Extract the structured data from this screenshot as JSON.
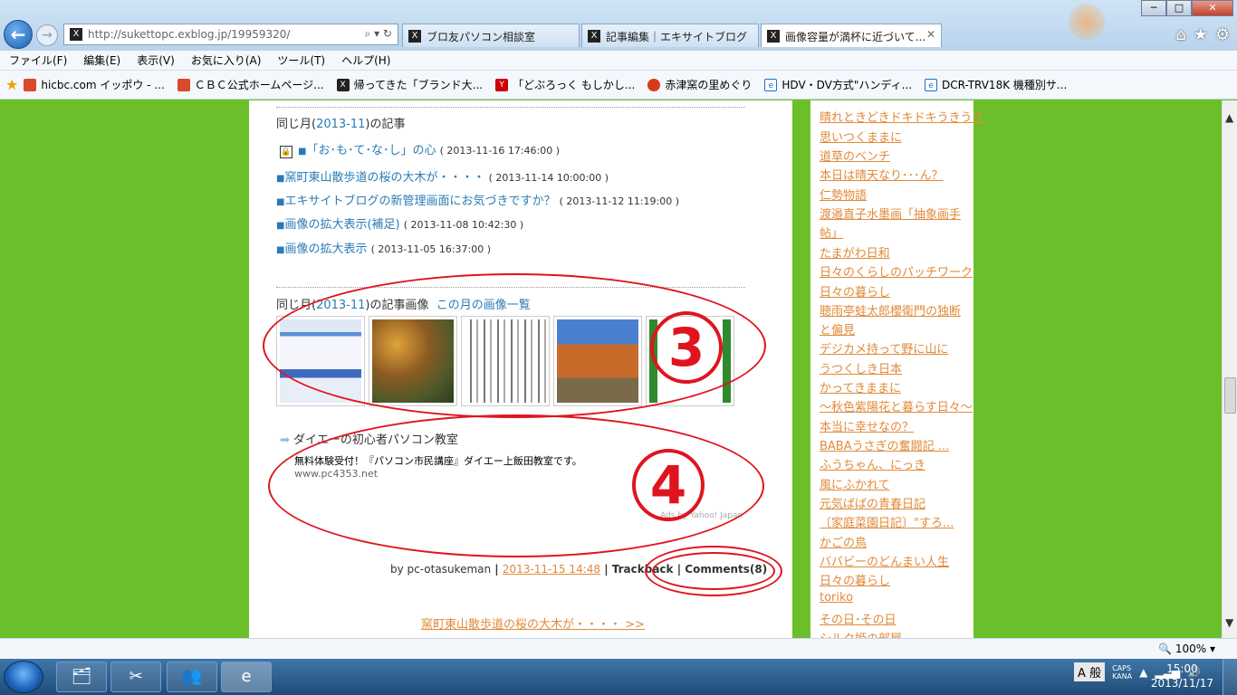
{
  "browser": {
    "address_url": "http://sukettopc.exblog.jp/19959320/",
    "tabs": [
      {
        "label": "ブロ友パソコン相談室"
      },
      {
        "label": "記事編集｜エキサイトブログ"
      },
      {
        "label": "画像容量が満杯に近づいて..."
      }
    ],
    "window_controls": {
      "minimize": "─",
      "maximize": "□",
      "close": "✕"
    },
    "tool_icons": {
      "home": "⌂",
      "favorites": "★",
      "tools": "⚙"
    }
  },
  "menu": [
    "ファイル(F)",
    "編集(E)",
    "表示(V)",
    "お気に入り(A)",
    "ツール(T)",
    "ヘルプ(H)"
  ],
  "favorites": [
    {
      "label": "hicbc.com  イッポウ - ...",
      "color": "#d84a2a"
    },
    {
      "label": "ＣＢＣ公式ホームページ...",
      "color": "#d84a2a"
    },
    {
      "label": "帰ってきた「ブランド大...",
      "color": "#222222"
    },
    {
      "label": "「どぶろっく もしかし...",
      "color": "#cc0000"
    },
    {
      "label": "赤津窯の里めぐり",
      "color": "#d83a1a"
    },
    {
      "label": "HDV・DV方式\"ハンディ...",
      "color": "#1a6fd8"
    },
    {
      "label": "DCR-TRV18K  機種別サ...",
      "color": "#1a6fd8"
    }
  ],
  "article": {
    "same_month_prefix": "同じ月(",
    "same_month_link": "2013-11",
    "same_month_suffix": ")の記事",
    "posts": [
      {
        "title": "「お･も･て･な･し」の心",
        "date": "( 2013-11-16 17:46:00 )",
        "locked": true
      },
      {
        "title": "窯町東山散歩道の桜の大木が・・・・",
        "date": "( 2013-11-14 10:00:00 )",
        "locked": false
      },
      {
        "title": "エキサイトブログの新管理画面にお気づきですか？",
        "date": "( 2013-11-12 11:19:00 )",
        "locked": false
      },
      {
        "title": "画像の拡大表示(補足)",
        "date": "( 2013-11-08 10:42:30 )",
        "locked": false
      },
      {
        "title": "画像の拡大表示",
        "date": "( 2013-11-05 16:37:00 )",
        "locked": false
      }
    ],
    "images_prefix": "同じ月(",
    "images_link": "2013-11",
    "images_suffix": ")の記事画像",
    "images_list_link": "この月の画像一覧",
    "ad": {
      "title": "ダイエーの初心者パソコン教室",
      "text": "無料体験受付！『パソコン市民講座』ダイエー上飯田教室です。",
      "url": "www.pc4353.net",
      "by": "Ads by Yahoo! Japan"
    },
    "byline_by": "by pc-otasukeman",
    "byline_sep": " | ",
    "byline_date": "2013-11-15 14:48",
    "byline_trackback": "Trackback",
    "byline_comments": "Comments(8)",
    "next_link": "窯町東山散歩道の桜の大木が・・・・ >>"
  },
  "sidebar": [
    "晴れときどきドキドキうきうき",
    "思いつくままに",
    "道草のベンチ",
    "本日は晴天なり･･･ん？",
    "仁勢物語",
    "渡邉直子水墨画「抽象画手",
    "帖」",
    "たまがわ日和",
    "日々のくらしのパッチワーク",
    "日々の暮らし",
    "聴雨亭蛙太郎櫻衛門の独断",
    "と偏見",
    "デジカメ持って野に山に",
    "うつくしき日本",
    "かってきままに",
    "～秋色紫陽花と暮らす日々～",
    "本当に幸せなの？",
    "BABAうさぎの奮闘記 ...",
    "ふうちゃん、にっき",
    "風にふかれて",
    "元気ばばの青春日記",
    "〔家庭菜園日記〕\"すろ...",
    "かごの鳥",
    "ババビーのどんまい人生",
    "日々の暮らし",
    "toriko",
    "その日･その日",
    "シルク姫の部屋"
  ],
  "annotations": {
    "num3": "3",
    "num4": "4"
  },
  "statusbar": {
    "zoom": "100%"
  },
  "taskbar": {
    "ime": "A 般",
    "caps": "CAPS",
    "kana": "KANA",
    "time": "15:00",
    "date": "2013/11/17"
  },
  "colors": {
    "page_bg": "#6bbf2a",
    "link": "#2a7bb5",
    "side_link": "#e08a3a",
    "annotation": "#e0141e"
  }
}
